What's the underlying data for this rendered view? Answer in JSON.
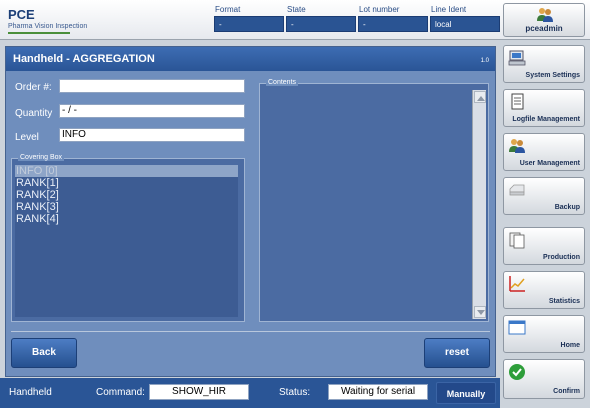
{
  "header": {
    "logo_main": "PCE",
    "logo_sub": "Pharma Vision Inspection",
    "fields": [
      {
        "label": "Format",
        "value": "-"
      },
      {
        "label": "State",
        "value": "-"
      },
      {
        "label": "Lot number",
        "value": "-"
      },
      {
        "label": "Line Ident",
        "value": "local"
      }
    ],
    "user": "pceadmin"
  },
  "panel": {
    "title": "Handheld - AGGREGATION",
    "version": "1.0",
    "order_label": "Order #:",
    "order_value": "",
    "quantity_label": "Quantity",
    "quantity_value": "- / -",
    "level_label": "Level",
    "level_value": "INFO",
    "covering_box_title": "Covering Box",
    "covering_box_items": [
      "INFO [0]",
      "RANK[1]",
      "RANK[2]",
      "RANK[3]",
      "RANK[4]"
    ],
    "contents_title": "Contents",
    "back_label": "Back",
    "reset_label": "reset"
  },
  "sidebar": {
    "items": [
      {
        "label": "System Settings",
        "icon": "computer-icon"
      },
      {
        "label": "Logfile Management",
        "icon": "document-icon"
      },
      {
        "label": "User Management",
        "icon": "users-icon"
      },
      {
        "label": "Backup",
        "icon": "drive-icon"
      },
      {
        "label": "Production",
        "icon": "pages-icon"
      },
      {
        "label": "Statistics",
        "icon": "chart-icon"
      },
      {
        "label": "Home",
        "icon": "window-icon"
      },
      {
        "label": "Confirm",
        "icon": "checkmark-icon"
      }
    ]
  },
  "statusbar": {
    "mode": "Handheld",
    "command_label": "Command:",
    "command_value": "SHOW_HIR",
    "status_label": "Status:",
    "status_value": "Waiting for serial",
    "manual_label": "Manually"
  },
  "colors": {
    "accent_blue": "#2a5596",
    "panel_blue": "#6f8ebd",
    "confirm_green": "#2e9e3a"
  }
}
